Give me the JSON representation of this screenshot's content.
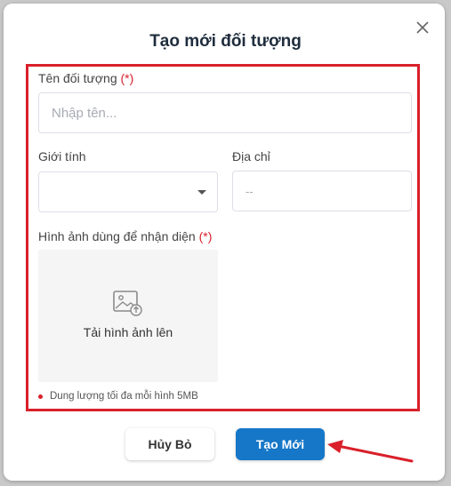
{
  "modal": {
    "title": "Tạo mới đối tượng",
    "close_icon": "close-icon"
  },
  "form": {
    "name": {
      "label": "Tên đối tượng",
      "required_mark": "(*)",
      "placeholder": "Nhập tên..."
    },
    "gender": {
      "label": "Giới tính",
      "value": ""
    },
    "address": {
      "label": "Địa chỉ",
      "placeholder": "--"
    },
    "image": {
      "label": "Hình ảnh dùng để nhận diện",
      "required_mark": "(*)",
      "upload_text": "Tải hình ảnh lên",
      "upload_icon": "image-upload-icon",
      "note": "Dung lượng tối đa mỗi hình 5MB"
    }
  },
  "footer": {
    "cancel_label": "Hủy Bỏ",
    "create_label": "Tạo Mới"
  },
  "colors": {
    "highlight": "#d9202b",
    "primary": "#1677c8",
    "required": "#d9202b"
  }
}
